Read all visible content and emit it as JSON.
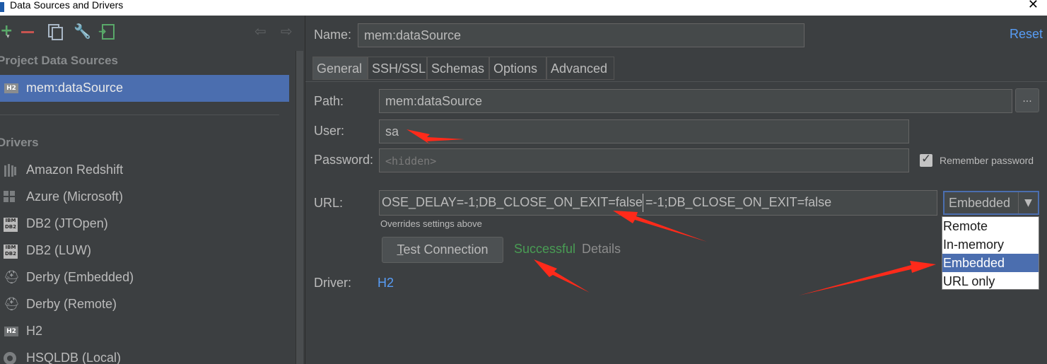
{
  "window": {
    "title": "Data Sources and Drivers",
    "close_glyph": "✕"
  },
  "toolbar": {
    "add_glyph": "+",
    "add_arrow_glyph": "▾",
    "gear_glyph": "🔧",
    "back_glyph": "⇦",
    "forward_glyph": "⇨"
  },
  "sidebar": {
    "project_header": "Project Data Sources",
    "data_sources": [
      {
        "label": "mem:dataSource",
        "badge": "H2"
      }
    ],
    "drivers_header": "Drivers",
    "drivers": [
      {
        "label": "Amazon Redshift",
        "icon": "redshift-icon"
      },
      {
        "label": "Azure (Microsoft)",
        "icon": "windows-icon"
      },
      {
        "label": "DB2 (JTOpen)",
        "icon": "ibm-db2-icon",
        "icon_text": "IBM DB2"
      },
      {
        "label": "DB2 (LUW)",
        "icon": "ibm-db2-icon",
        "icon_text": "IBM DB2"
      },
      {
        "label": "Derby (Embedded)",
        "icon": "derby-hat-icon",
        "icon_glyph": "⛑"
      },
      {
        "label": "Derby (Remote)",
        "icon": "derby-hat-icon",
        "icon_glyph": "⛑"
      },
      {
        "label": "H2",
        "icon": "h2-icon",
        "badge": "H2"
      },
      {
        "label": "HSQLDB (Local)",
        "icon": "hsqldb-icon"
      }
    ]
  },
  "main": {
    "name_label": "Name:",
    "name_value": "mem:dataSource",
    "reset_label": "Reset",
    "tabs": [
      {
        "label": "General",
        "selected": true
      },
      {
        "label": "SSH/SSL",
        "selected": false
      },
      {
        "label": "Schemas",
        "selected": false
      },
      {
        "label": "Options",
        "selected": false
      },
      {
        "label": "Advanced",
        "selected": false
      }
    ],
    "path_label": "Path:",
    "path_value": "mem:dataSource",
    "path_button": "...",
    "user_label": "User:",
    "user_value": "sa",
    "password_label": "Password:",
    "password_placeholder": "<hidden>",
    "remember_password_label": "Remember password",
    "remember_password_checked": true,
    "url_label": "URL:",
    "url_value_left": "OSE_DELAY=-1;DB_CLOSE_ON_EXIT=false",
    "url_value_right": "=-1;DB_CLOSE_ON_EXIT=false",
    "url_hint": "Overrides settings above",
    "url_type_selected": "Embedded",
    "url_type_arrow": "▼",
    "url_type_options": [
      {
        "label": "Remote",
        "selected": false
      },
      {
        "label": "In-memory",
        "selected": false
      },
      {
        "label": "Embedded",
        "selected": true
      },
      {
        "label": "URL only",
        "selected": false
      }
    ],
    "test_connection_mnemonic": "T",
    "test_connection_rest": "est Connection",
    "test_status": "Successful",
    "test_status_color": "#499c54",
    "details_label": "Details",
    "driver_label": "Driver:",
    "driver_value": "H2"
  },
  "colors": {
    "background": "#3c3f41",
    "selection": "#4b6eaf",
    "link": "#589df6",
    "annotation_arrow": "#ff2a1a"
  }
}
